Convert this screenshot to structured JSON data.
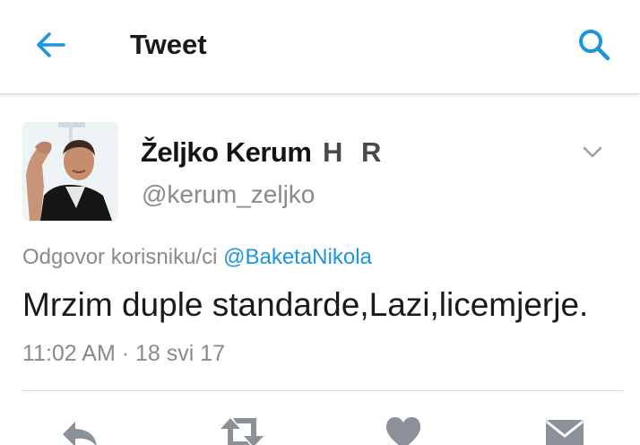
{
  "header": {
    "title": "Tweet",
    "back_icon": "arrow-left-icon",
    "search_icon": "search-icon",
    "accent_color": "#1b95e0"
  },
  "tweet": {
    "author_name": "Željko Kerum",
    "author_flag": "H R",
    "author_handle": "@kerum_zeljko",
    "reply_prefix": "Odgovor korisniku/ci",
    "reply_to": "@BaketaNikola",
    "text": "Mrzim duple standarde,Lazi,licemjerje.",
    "timestamp": "11:02 AM · 18 svi 17"
  },
  "actions": [
    {
      "name": "reply",
      "icon": "reply-icon"
    },
    {
      "name": "retweet",
      "icon": "retweet-icon"
    },
    {
      "name": "like",
      "icon": "heart-icon"
    },
    {
      "name": "message",
      "icon": "envelope-icon"
    }
  ]
}
